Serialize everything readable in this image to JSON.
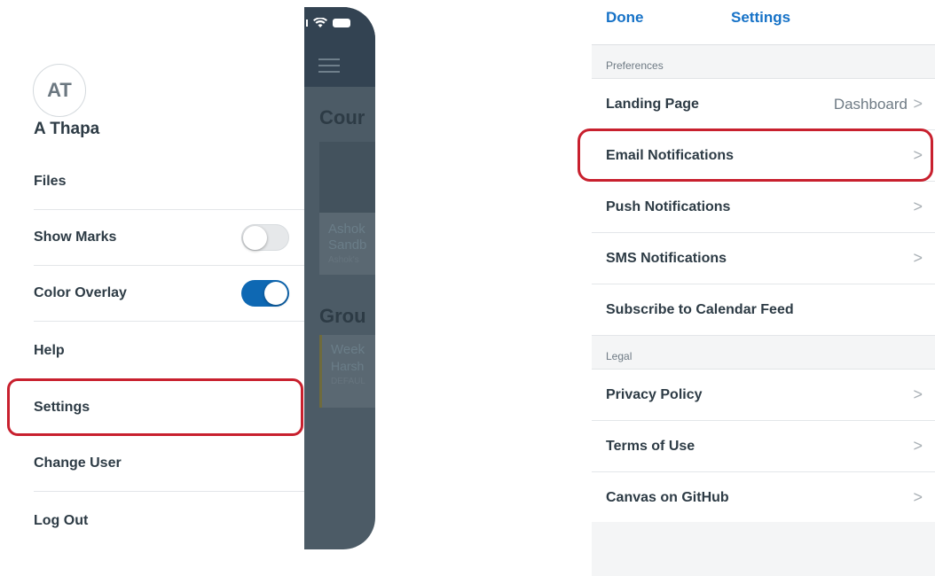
{
  "drawer": {
    "avatar_initials": "AT",
    "user_name": "A Thapa",
    "items": [
      {
        "label": "Files"
      },
      {
        "label": "Show Marks",
        "toggle": "off"
      },
      {
        "label": "Color Overlay",
        "toggle": "on"
      },
      {
        "label": "Help"
      },
      {
        "label": "Settings"
      },
      {
        "label": "Change User"
      },
      {
        "label": "Log Out"
      }
    ]
  },
  "dashboard_peek": {
    "courses_heading": "Cour",
    "course_title_1": "Ashok",
    "course_title_2": "Sandb",
    "course_sub": "Ashok's",
    "groups_heading": "Grou",
    "group_title": "Week",
    "group_owner": "Harsh",
    "group_tag": "DEFAUL"
  },
  "settings": {
    "nav": {
      "done_label": "Done",
      "title": "Settings"
    },
    "sections": [
      {
        "header": "Preferences",
        "rows": [
          {
            "label": "Landing Page",
            "value": "Dashboard"
          },
          {
            "label": "Email Notifications"
          },
          {
            "label": "Push Notifications"
          },
          {
            "label": "SMS Notifications"
          },
          {
            "label": "Subscribe to Calendar Feed"
          }
        ]
      },
      {
        "header": "Legal",
        "rows": [
          {
            "label": "Privacy Policy"
          },
          {
            "label": "Terms of Use"
          },
          {
            "label": "Canvas on GitHub"
          }
        ]
      }
    ],
    "chevron": ">"
  },
  "colors": {
    "accent": "#1672c7",
    "highlight": "#c8202e",
    "toggle_on": "#0e68b3"
  }
}
